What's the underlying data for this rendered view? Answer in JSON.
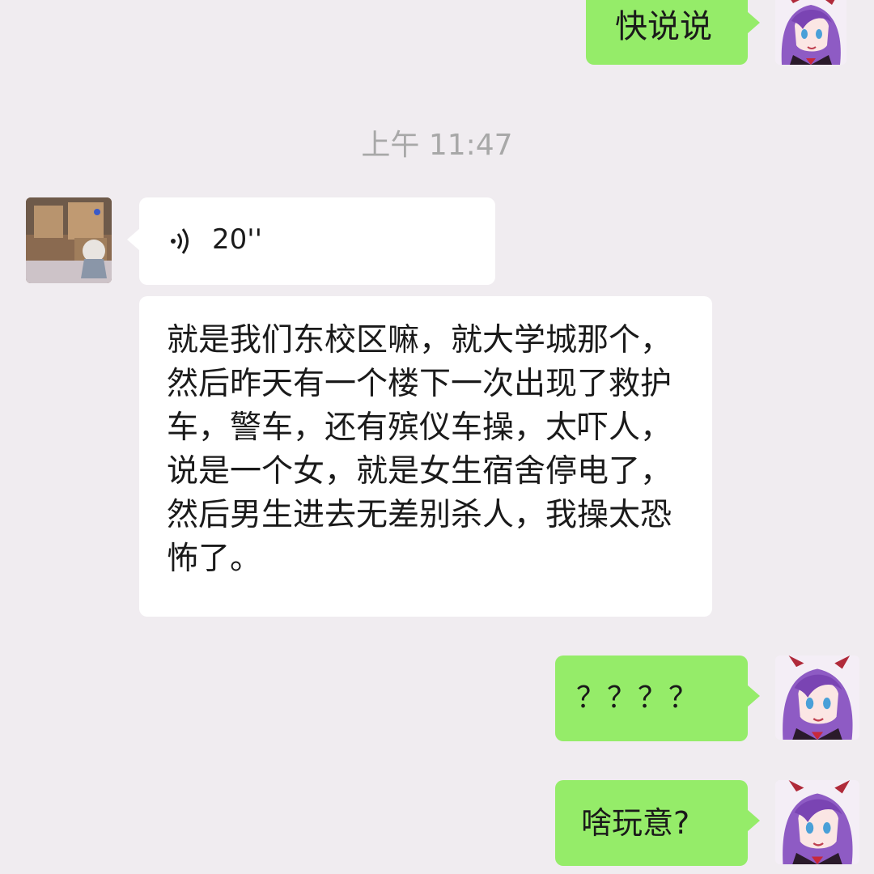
{
  "messages": [
    {
      "side": "right",
      "type": "text",
      "text": "快说说"
    },
    {
      "type": "timestamp",
      "text": "上午 11:47"
    },
    {
      "side": "left",
      "type": "voice",
      "duration": "20''"
    },
    {
      "side": "left",
      "type": "text",
      "text": "就是我们东校区嘛，就大学城那个，然后昨天有一个楼下一次出现了救护车，警车，还有殡仪车操，太吓人，说是一个女，就是女生宿舍停电了，然后男生进去无差别杀人，我操太恐怖了。"
    },
    {
      "side": "right",
      "type": "text",
      "text": "？？？？"
    },
    {
      "side": "right",
      "type": "text",
      "text": "啥玩意?"
    }
  ],
  "colors": {
    "background": "#f0ecf0",
    "bubble_self": "#95ec69",
    "bubble_other": "#ffffff",
    "timestamp": "#a8a8a8"
  },
  "icons": {
    "voice": "voice-wave-icon",
    "self_avatar": "purple-hair-anime-girl-avatar",
    "other_avatar": "photo-avatar"
  }
}
